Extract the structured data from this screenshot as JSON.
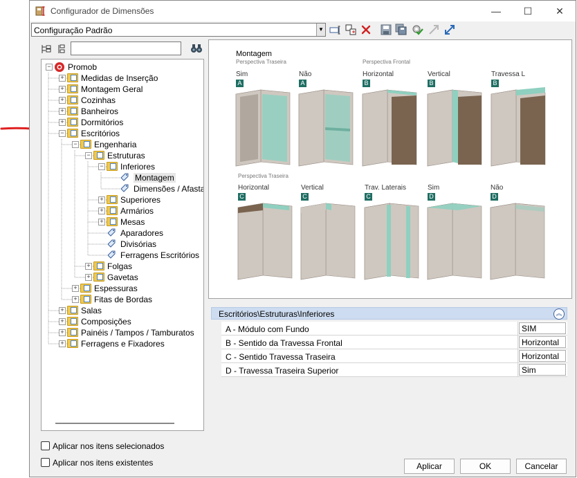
{
  "window": {
    "title": "Configurador de Dimensões",
    "minimize": "—",
    "maximize": "☐",
    "close": "✕"
  },
  "config": {
    "selected": "Configuração Padrão"
  },
  "tree": {
    "search": {
      "value": ""
    },
    "nodes": [
      {
        "label": "Promob",
        "depth": 0,
        "expanded": true,
        "icon": "promob-logo-icon"
      },
      {
        "label": "Medidas de Inserção",
        "depth": 1,
        "expanded": false,
        "icon": "folder-icon"
      },
      {
        "label": "Montagem Geral",
        "depth": 1,
        "expanded": false,
        "icon": "folder-icon"
      },
      {
        "label": "Cozinhas",
        "depth": 1,
        "expanded": false,
        "icon": "folder-icon"
      },
      {
        "label": "Banheiros",
        "depth": 1,
        "expanded": false,
        "icon": "folder-icon"
      },
      {
        "label": "Dormitórios",
        "depth": 1,
        "expanded": false,
        "icon": "folder-icon"
      },
      {
        "label": "Escritórios",
        "depth": 1,
        "expanded": true,
        "icon": "folder-icon"
      },
      {
        "label": "Engenharia",
        "depth": 2,
        "expanded": true,
        "icon": "folder-icon"
      },
      {
        "label": "Estruturas",
        "depth": 3,
        "expanded": true,
        "icon": "folder-icon"
      },
      {
        "label": "Inferiores",
        "depth": 4,
        "expanded": true,
        "icon": "folder-icon"
      },
      {
        "label": "Montagem",
        "depth": 5,
        "expanded": null,
        "icon": "tag-icon",
        "selected": true
      },
      {
        "label": "Dimensões / Afastamentos",
        "depth": 5,
        "expanded": null,
        "icon": "tag-icon"
      },
      {
        "label": "Superiores",
        "depth": 4,
        "expanded": false,
        "icon": "folder-icon"
      },
      {
        "label": "Armários",
        "depth": 4,
        "expanded": false,
        "icon": "folder-icon"
      },
      {
        "label": "Mesas",
        "depth": 4,
        "expanded": false,
        "icon": "folder-icon"
      },
      {
        "label": "Aparadores",
        "depth": 4,
        "expanded": null,
        "icon": "tag-icon"
      },
      {
        "label": "Divisórias",
        "depth": 4,
        "expanded": null,
        "icon": "tag-icon"
      },
      {
        "label": "Ferragens Escritórios",
        "depth": 4,
        "expanded": null,
        "icon": "tag-icon"
      },
      {
        "label": "Folgas",
        "depth": 3,
        "expanded": false,
        "icon": "folder-icon"
      },
      {
        "label": "Gavetas",
        "depth": 3,
        "expanded": false,
        "icon": "folder-icon"
      },
      {
        "label": "Espessuras",
        "depth": 2,
        "expanded": false,
        "icon": "folder-icon"
      },
      {
        "label": "Fitas de Bordas",
        "depth": 2,
        "expanded": false,
        "icon": "folder-icon"
      },
      {
        "label": "Salas",
        "depth": 1,
        "expanded": false,
        "icon": "folder-icon"
      },
      {
        "label": "Composições",
        "depth": 1,
        "expanded": false,
        "icon": "folder-icon"
      },
      {
        "label": "Painéis / Tampos / Tamburatos",
        "depth": 1,
        "expanded": false,
        "icon": "folder-icon"
      },
      {
        "label": "Ferragens e Fixadores",
        "depth": 1,
        "expanded": false,
        "icon": "folder-icon"
      }
    ]
  },
  "checkboxes": [
    {
      "label": "Aplicar nos itens selecionados",
      "checked": false
    },
    {
      "label": "Aplicar nos itens existentes",
      "checked": false
    }
  ],
  "preview": {
    "title": "Montagem",
    "row1_sub_left": "Perspectiva Traseira",
    "row1_sub_right": "Perspectiva Frontal",
    "row2_sub": "Perspectiva Traseira",
    "row1": [
      {
        "label": "Sim",
        "letter": "A"
      },
      {
        "label": "Não",
        "letter": "A"
      },
      {
        "label": "Horizontal",
        "letter": "B"
      },
      {
        "label": "Vertical",
        "letter": "B"
      },
      {
        "label": "Travessa L",
        "letter": "B"
      }
    ],
    "row2": [
      {
        "label": "Horizontal",
        "letter": "C"
      },
      {
        "label": "Vertical",
        "letter": "C"
      },
      {
        "label": "Trav. Laterais",
        "letter": "C"
      },
      {
        "label": "Sim",
        "letter": "D"
      },
      {
        "label": "Não",
        "letter": "D"
      }
    ],
    "colors": {
      "body": "#cfc8c0",
      "side": "#bdb5ab",
      "top": "#e0dad3",
      "wood": "#7a6450",
      "glass": "#8fd0c0",
      "label": "#1f6e63"
    }
  },
  "properties": {
    "header": "Escritórios\\Estruturas\\Inferiores",
    "rows": [
      {
        "label": "A - Módulo com Fundo",
        "value": "SIM"
      },
      {
        "label": "B - Sentido da Travessa Frontal",
        "value": "Horizontal"
      },
      {
        "label": "C - Sentido Travessa Traseira",
        "value": "Horizontal"
      },
      {
        "label": "D - Travessa Traseira Superior",
        "value": "Sim"
      }
    ]
  },
  "buttons": {
    "apply": "Aplicar",
    "ok": "OK",
    "cancel": "Cancelar"
  },
  "annotation": {
    "arrow_color": "#e02020"
  }
}
